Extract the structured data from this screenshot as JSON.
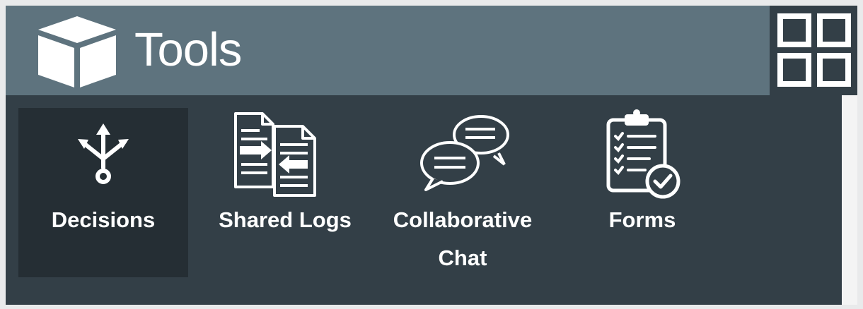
{
  "header": {
    "title": "Tools",
    "app_icon": "cube-icon",
    "menu_icon": "grid-icon"
  },
  "tools": [
    {
      "label": "Decisions",
      "icon": "branching-arrows-icon",
      "selected": true
    },
    {
      "label": "Shared Logs",
      "icon": "document-exchange-icon",
      "selected": false
    },
    {
      "label": "Collaborative Chat",
      "icon": "chat-bubbles-icon",
      "selected": false
    },
    {
      "label": "Forms",
      "icon": "clipboard-check-icon",
      "selected": false
    }
  ],
  "colors": {
    "header_background": "#5e737e",
    "panel_background": "#333f47",
    "selected_background": "#252e34",
    "text": "#ffffff"
  }
}
